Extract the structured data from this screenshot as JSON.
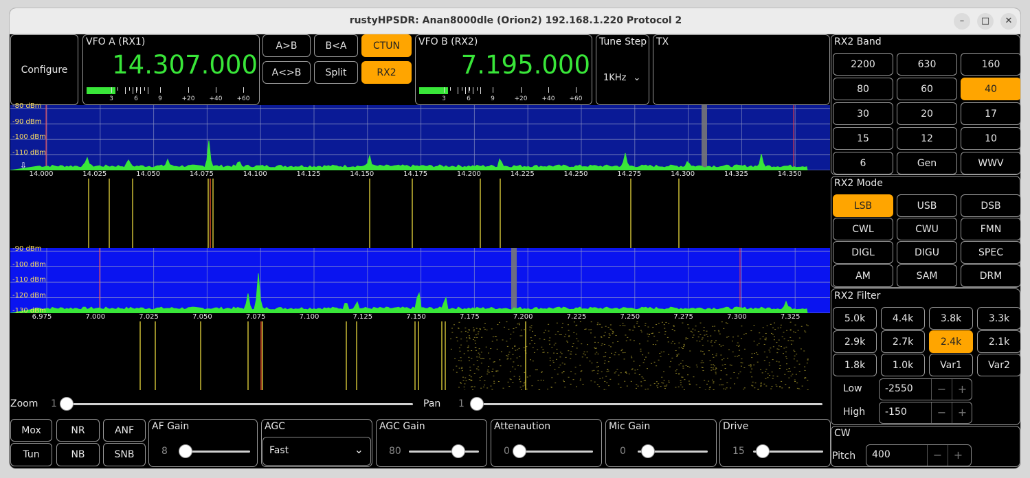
{
  "window": {
    "title": "rustyHPSDR: Anan8000dle (Orion2) 192.168.1.220 Protocol 2",
    "minimize": "–",
    "maximize": "□",
    "close": "✕"
  },
  "configure": "Configure",
  "vfo_a": {
    "label": "VFO A (RX1)",
    "freq": "14.307.000"
  },
  "vfo_b": {
    "label": "VFO B (RX2)",
    "freq": "7.195.000"
  },
  "meter_ticks": [
    "3",
    "6",
    "9",
    "+20",
    "+40",
    "+60"
  ],
  "vfo_buttons": {
    "a_to_b": "A>B",
    "b_to_a": "B<A",
    "ctun": "CTUN",
    "swap": "A<>B",
    "split": "Split",
    "rx2": "RX2"
  },
  "tune_step": {
    "label": "Tune Step",
    "value": "1KHz"
  },
  "tx": {
    "label": "TX"
  },
  "rx1_spectrum": {
    "db_labels": [
      "-80 dBm",
      "-90 dBm",
      "-100 dBm",
      "-110 dBm"
    ],
    "freq_labels": [
      "14.000",
      "14.025",
      "14.050",
      "14.075",
      "14.100",
      "14.125",
      "14.150",
      "14.175",
      "14.200",
      "14.225",
      "14.250",
      "14.275",
      "14.300",
      "14.325",
      "14.350"
    ]
  },
  "rx2_spectrum": {
    "db_labels": [
      "-90 dBm",
      "-100 dBm",
      "-110 dBm",
      "-120 dBm",
      "-130 dBm"
    ],
    "freq_labels": [
      "6.975",
      "7.000",
      "7.025",
      "7.050",
      "7.075",
      "7.100",
      "7.125",
      "7.150",
      "7.175",
      "7.200",
      "7.225",
      "7.250",
      "7.275",
      "7.300",
      "7.325"
    ]
  },
  "zoom": {
    "label": "Zoom",
    "value": "1"
  },
  "pan": {
    "label": "Pan",
    "value": "1"
  },
  "bottom_buttons": {
    "mox": "Mox",
    "nr": "NR",
    "anf": "ANF",
    "tun": "Tun",
    "nb": "NB",
    "snb": "SNB"
  },
  "af_gain": {
    "label": "AF Gain",
    "value": "8"
  },
  "agc": {
    "label": "AGC",
    "value": "Fast"
  },
  "agc_gain": {
    "label": "AGC Gain",
    "value": "80"
  },
  "attenuation": {
    "label": "Attenaution",
    "value": "0"
  },
  "mic_gain": {
    "label": "Mic Gain",
    "value": "0"
  },
  "drive": {
    "label": "Drive",
    "value": "15"
  },
  "band": {
    "label": "RX2 Band",
    "items": [
      "2200",
      "630",
      "160",
      "80",
      "60",
      "40",
      "30",
      "20",
      "17",
      "15",
      "12",
      "10",
      "6",
      "Gen",
      "WWV"
    ],
    "selected": "40"
  },
  "mode": {
    "label": "RX2 Mode",
    "items": [
      "LSB",
      "USB",
      "DSB",
      "CWL",
      "CWU",
      "FMN",
      "DIGL",
      "DIGU",
      "SPEC",
      "AM",
      "SAM",
      "DRM"
    ],
    "selected": "LSB"
  },
  "filter": {
    "label": "RX2 Filter",
    "items": [
      "5.0k",
      "4.4k",
      "3.8k",
      "3.3k",
      "2.9k",
      "2.7k",
      "2.4k",
      "2.1k",
      "1.8k",
      "1.0k",
      "Var1",
      "Var2"
    ],
    "selected": "2.4k",
    "low_label": "Low",
    "low_value": "-2550",
    "high_label": "High",
    "high_value": "-150"
  },
  "cw": {
    "label": "CW",
    "pitch_label": "Pitch",
    "pitch_value": "400"
  },
  "spin_minus": "−",
  "spin_plus": "+",
  "colors": {
    "accent": "#ffa500",
    "frequency": "#39e639",
    "spectrum_rx1_bg": "#0a1a96",
    "spectrum_rx2_bg": "#0a14f0",
    "signal": "#39e639"
  }
}
